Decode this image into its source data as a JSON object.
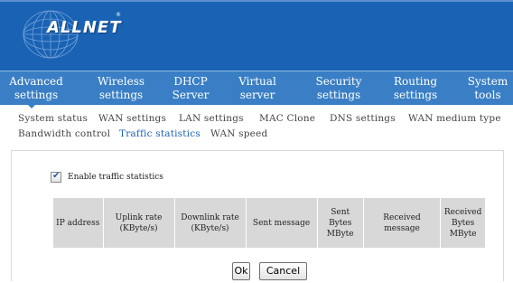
{
  "brand": {
    "logo": "ALLNET",
    "reg_mark": "®"
  },
  "menu": [
    {
      "line1": "Advanced",
      "line2": "settings"
    },
    {
      "line1": "Wireless",
      "line2": "settings"
    },
    {
      "line1": "DHCP",
      "line2": "Server"
    },
    {
      "line1": "Virtual",
      "line2": "server"
    },
    {
      "line1": "Security",
      "line2": "settings"
    },
    {
      "line1": "Routing",
      "line2": "settings"
    },
    {
      "line1": "System",
      "line2": "tools"
    }
  ],
  "subnav": [
    "System status",
    "WAN settings",
    "LAN settings",
    "MAC Clone",
    "DNS settings",
    "WAN medium type",
    "Bandwidth control",
    "Traffic statistics",
    "WAN speed"
  ],
  "enable": {
    "label": "Enable traffic statistics",
    "checked": true,
    "tick": "✔"
  },
  "table": {
    "headers": [
      {
        "l1": "IP address",
        "l2": "",
        "l3": ""
      },
      {
        "l1": "Uplink rate",
        "l2": "(KByte/s)",
        "l3": ""
      },
      {
        "l1": "Downlink rate",
        "l2": "(KByte/s)",
        "l3": ""
      },
      {
        "l1": "Sent message",
        "l2": "",
        "l3": ""
      },
      {
        "l1": "Sent Bytes",
        "l2": "MByte",
        "l3": ""
      },
      {
        "l1": "Received message",
        "l2": "",
        "l3": ""
      },
      {
        "l1": "Received",
        "l2": "Bytes",
        "l3": "MByte"
      }
    ]
  },
  "buttons": {
    "ok": "Ok",
    "cancel": "Cancel"
  },
  "colors": {
    "header": "#1a63b4",
    "menubar": "#3a7fc5",
    "active_link": "#1a63b4",
    "table_header": "#d8d8d8"
  }
}
